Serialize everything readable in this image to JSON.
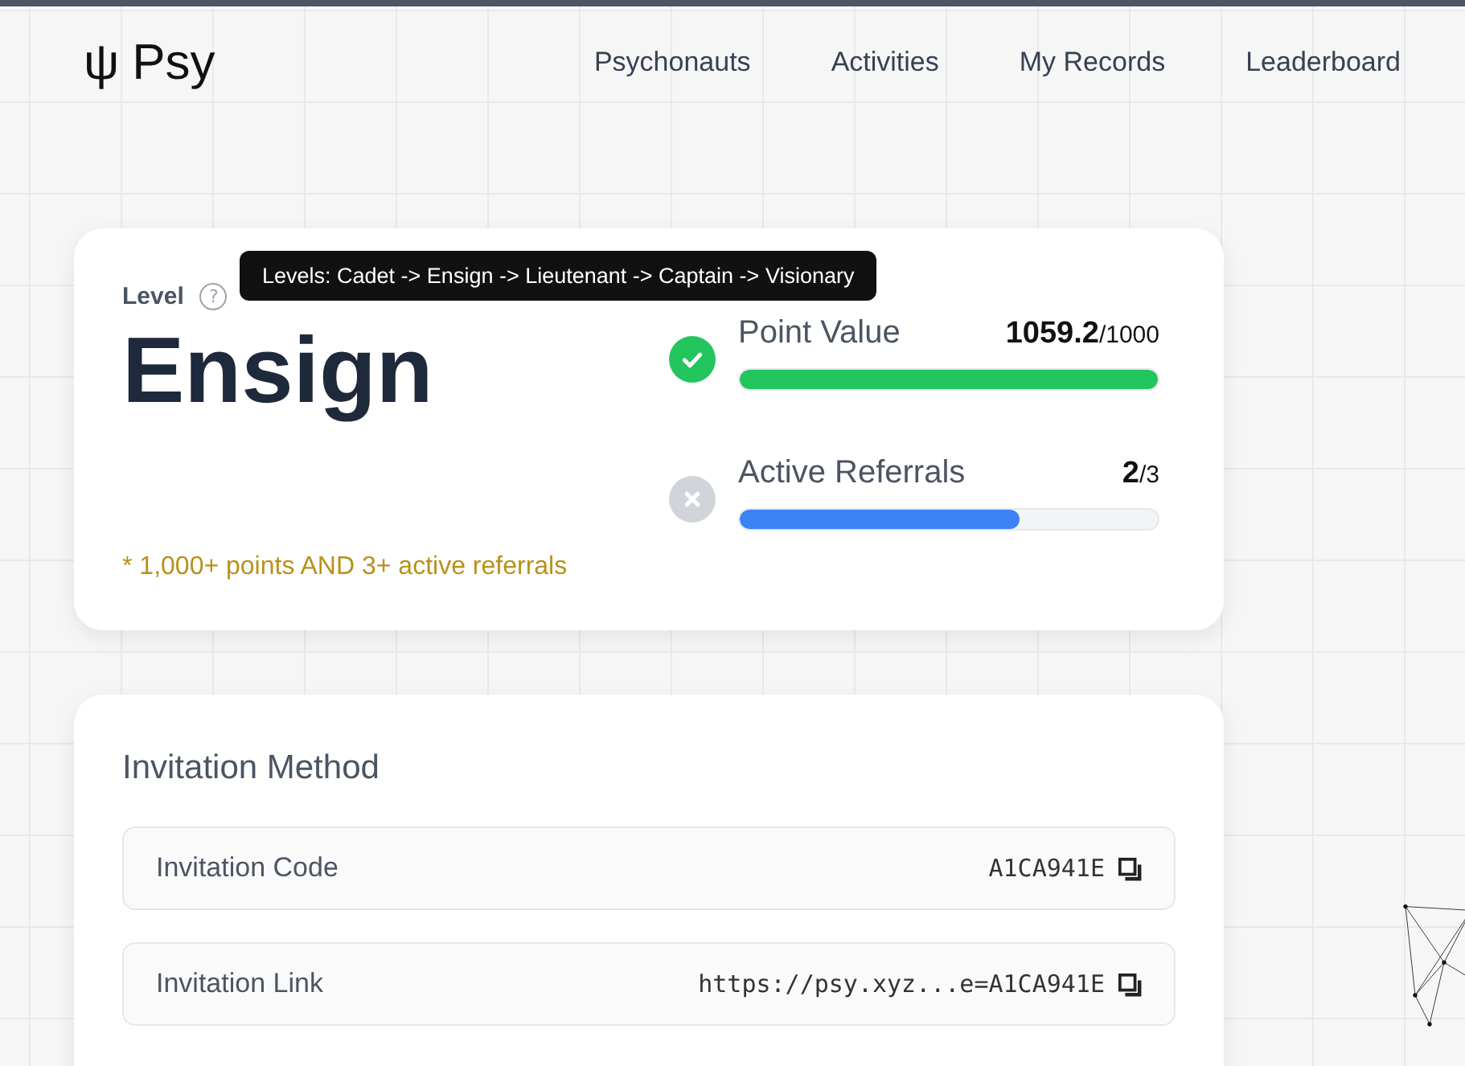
{
  "logo": {
    "symbol": "ψ",
    "name": "Psy"
  },
  "nav": [
    {
      "label": "Psychonauts",
      "selected": false
    },
    {
      "label": "Activities",
      "selected": false
    },
    {
      "label": "My Records",
      "selected": false
    },
    {
      "label": "Leaderboard",
      "selected": false
    }
  ],
  "level_card": {
    "label": "Level",
    "help": "?",
    "tooltip": "Levels: Cadet -> Ensign -> Lieutenant -> Captain -> Visionary",
    "level": "Ensign",
    "requirement": "* 1,000+ points AND 3+ active referrals",
    "metrics": [
      {
        "label": "Point Value",
        "value": "1059.2",
        "target": "/1000",
        "met": true,
        "level": 1,
        "color": "#22c55e"
      },
      {
        "label": "Active Referrals",
        "value": "2",
        "target": "/3",
        "met": false,
        "level": 0.67,
        "color": "#3b82f6"
      }
    ]
  },
  "invitation": {
    "title": "Invitation Method",
    "rows": [
      {
        "label": "Invitation Code",
        "value": "A1CA941E"
      },
      {
        "label": "Invitation Link",
        "value": "https://psy.xyz...e=A1CA941E"
      }
    ]
  }
}
